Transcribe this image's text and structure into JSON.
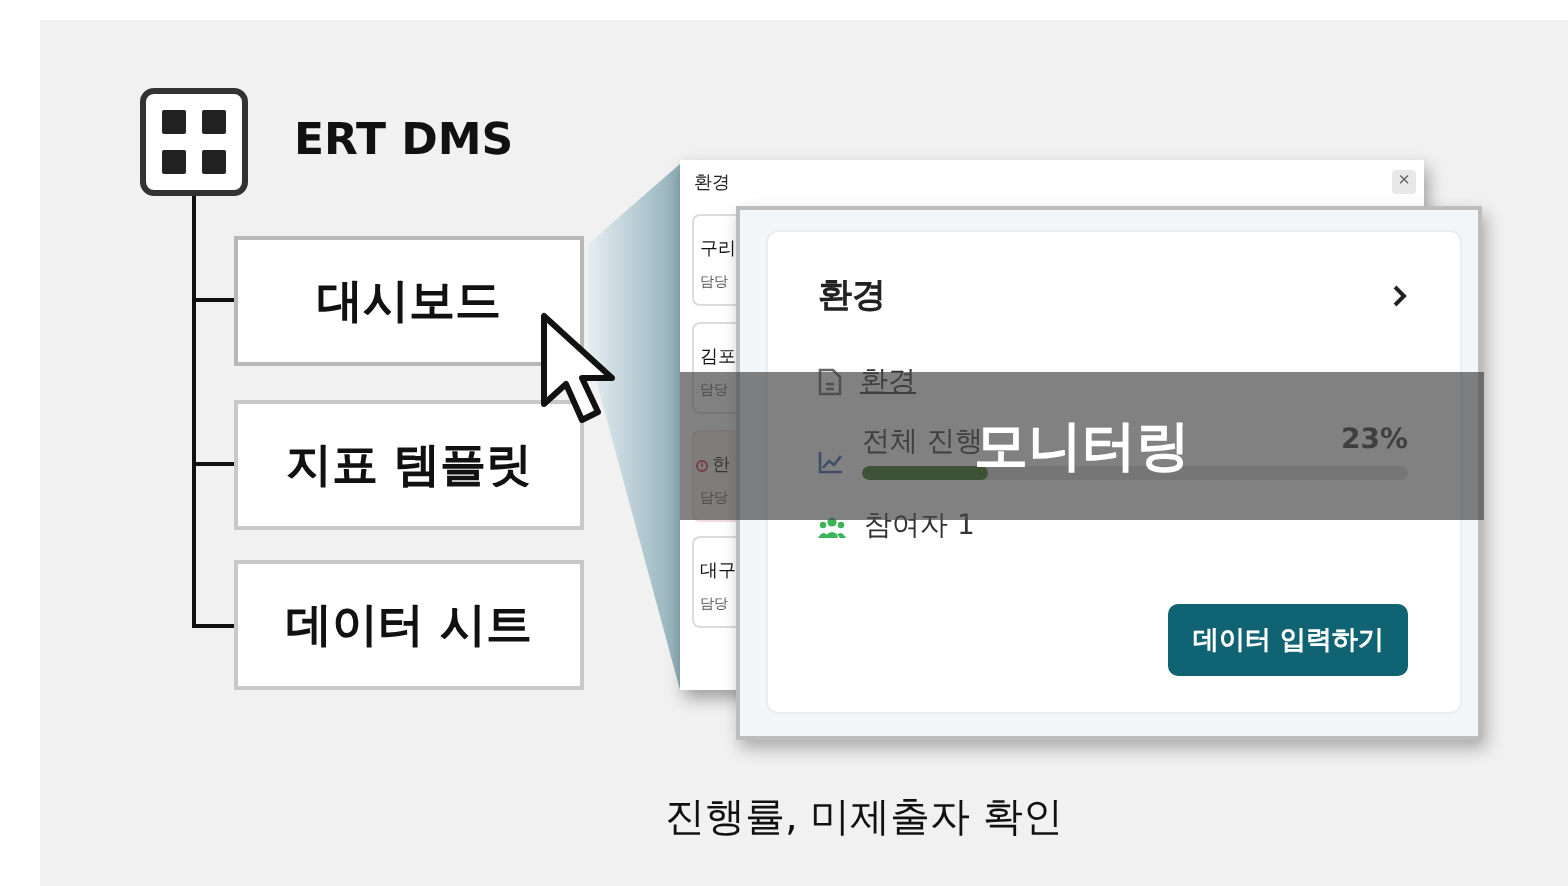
{
  "logo": {
    "title": "ERT DMS"
  },
  "menu": [
    {
      "label": "대시보드",
      "selected": true
    },
    {
      "label": "지표 템플릿",
      "selected": false
    },
    {
      "label": "데이터 시트",
      "selected": false
    }
  ],
  "back_window": {
    "title": "환경",
    "close": "×",
    "cards": [
      {
        "kind": "normal",
        "title": "구리",
        "subtitle": "담당"
      },
      {
        "kind": "normal",
        "title": "김포",
        "subtitle": "담당"
      },
      {
        "kind": "warning",
        "title": "한",
        "subtitle": "담당"
      },
      {
        "kind": "normal",
        "title": "대구",
        "subtitle": "담당"
      }
    ]
  },
  "card": {
    "title": "환경",
    "link": "환경",
    "progress": {
      "label": "전체 진행",
      "value": "23%",
      "level": 0.23
    },
    "participants": "참여자 1",
    "button": "데이터 입력하기"
  },
  "overlay": {
    "label": "모니터링"
  },
  "caption": "진행률, 미제출자 확인"
}
